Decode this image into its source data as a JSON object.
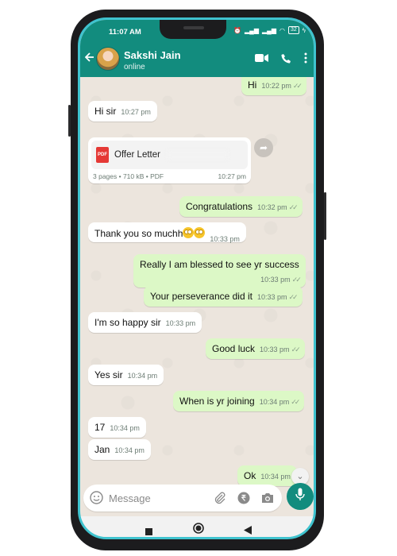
{
  "status_bar": {
    "time": "11:07 AM",
    "battery": "32"
  },
  "header": {
    "contact_name": "Sakshi Jain",
    "contact_status": "online"
  },
  "messages": [
    {
      "dir": "out",
      "text": "Hi",
      "time": "10:22 pm"
    },
    {
      "dir": "in",
      "text": "Hi sir",
      "time": "10:27 pm"
    },
    {
      "dir": "in",
      "type": "document",
      "file_label": "Offer Letter",
      "file_type": "PDF",
      "meta": "3 pages • 710 kB • PDF",
      "time": "10:27 pm"
    },
    {
      "dir": "out",
      "text": "Congratulations",
      "time": "10:32 pm"
    },
    {
      "dir": "in",
      "text": "Thank you so muchh",
      "time": "10:33 pm"
    },
    {
      "dir": "out",
      "text": "Really I am blessed to see yr success",
      "time": "10:33 pm"
    },
    {
      "dir": "out",
      "text": "Your perseverance did it",
      "time": "10:33 pm"
    },
    {
      "dir": "in",
      "text": "I'm so happy sir",
      "time": "10:33 pm"
    },
    {
      "dir": "out",
      "text": "Good luck",
      "time": "10:33 pm"
    },
    {
      "dir": "in",
      "text": "Yes sir",
      "time": "10:34 pm"
    },
    {
      "dir": "out",
      "text": "When is yr joining",
      "time": "10:34 pm"
    },
    {
      "dir": "in",
      "text": "17",
      "time": "10:34 pm"
    },
    {
      "dir": "in",
      "text": "Jan",
      "time": "10:34 pm"
    },
    {
      "dir": "out",
      "text": "Ok",
      "time": "10:34 pm"
    }
  ],
  "composer": {
    "placeholder": "Message"
  },
  "icons": {
    "header": [
      "back-arrow-icon",
      "video-call-icon",
      "voice-call-icon",
      "more-menu-icon"
    ],
    "composer": [
      "emoji-icon",
      "attach-icon",
      "rupee-payment-icon",
      "camera-icon",
      "mic-icon"
    ],
    "nav": [
      "recents-icon",
      "home-icon",
      "back-icon"
    ]
  },
  "colors": {
    "header_green": "#128c7e",
    "chat_bg": "#ece5dd",
    "outgoing_bubble": "#dcf8c6",
    "incoming_bubble": "#ffffff",
    "phone_accent": "#3fc3cf"
  }
}
